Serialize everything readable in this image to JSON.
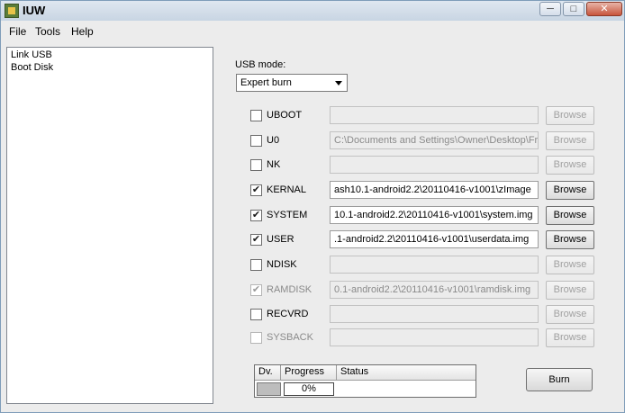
{
  "window": {
    "title": "IUW"
  },
  "title_buttons": {
    "minimize": "─",
    "maximize": "□",
    "close": "✕"
  },
  "menu": {
    "items": [
      "File",
      "Tools",
      "Help"
    ]
  },
  "left_list": {
    "items": [
      "Link USB",
      "Boot Disk"
    ]
  },
  "usb_mode": {
    "label": "USB mode:",
    "selected": "Expert burn"
  },
  "rows": [
    {
      "label": "UBOOT",
      "checked": false,
      "enabled": true,
      "path": "",
      "path_enabled": false,
      "browse": "Browse",
      "browse_enabled": false
    },
    {
      "label": "U0",
      "checked": false,
      "enabled": true,
      "path": "C:\\Documents and Settings\\Owner\\Desktop\\Fr",
      "path_enabled": false,
      "browse": "Browse",
      "browse_enabled": false
    },
    {
      "label": "NK",
      "checked": false,
      "enabled": true,
      "path": "",
      "path_enabled": false,
      "browse": "Browse",
      "browse_enabled": false
    },
    {
      "label": "KERNAL",
      "checked": true,
      "enabled": true,
      "path": "ash10.1-android2.2\\20110416-v1001\\zImage",
      "path_enabled": true,
      "browse": "Browse",
      "browse_enabled": true
    },
    {
      "label": "SYSTEM",
      "checked": true,
      "enabled": true,
      "path": "10.1-android2.2\\20110416-v1001\\system.img",
      "path_enabled": true,
      "browse": "Browse",
      "browse_enabled": true
    },
    {
      "label": "USER",
      "checked": true,
      "enabled": true,
      "path": ".1-android2.2\\20110416-v1001\\userdata.img",
      "path_enabled": true,
      "browse": "Browse",
      "browse_enabled": true
    },
    {
      "label": "NDISK",
      "checked": false,
      "enabled": true,
      "path": "",
      "path_enabled": false,
      "browse": "Browse",
      "browse_enabled": false
    },
    {
      "label": "RAMDISK",
      "checked": true,
      "enabled": false,
      "path": "0.1-android2.2\\20110416-v1001\\ramdisk.img",
      "path_enabled": false,
      "browse": "Browse",
      "browse_enabled": false
    },
    {
      "label": "RECVRD",
      "checked": false,
      "enabled": true,
      "path": "",
      "path_enabled": false,
      "browse": "Browse",
      "browse_enabled": false
    },
    {
      "label": "SYSBACK",
      "checked": false,
      "enabled": false,
      "path": "",
      "path_enabled": false,
      "browse": "Browse",
      "browse_enabled": false
    }
  ],
  "progress_table": {
    "headers": [
      "Dv.",
      "Progress",
      "Status"
    ],
    "progress_value": "0%",
    "status_value": ""
  },
  "actions": {
    "burn": "Burn"
  },
  "icons": {
    "app": "app-icon",
    "dropdown": "chevron-down-icon",
    "check": "✔"
  }
}
